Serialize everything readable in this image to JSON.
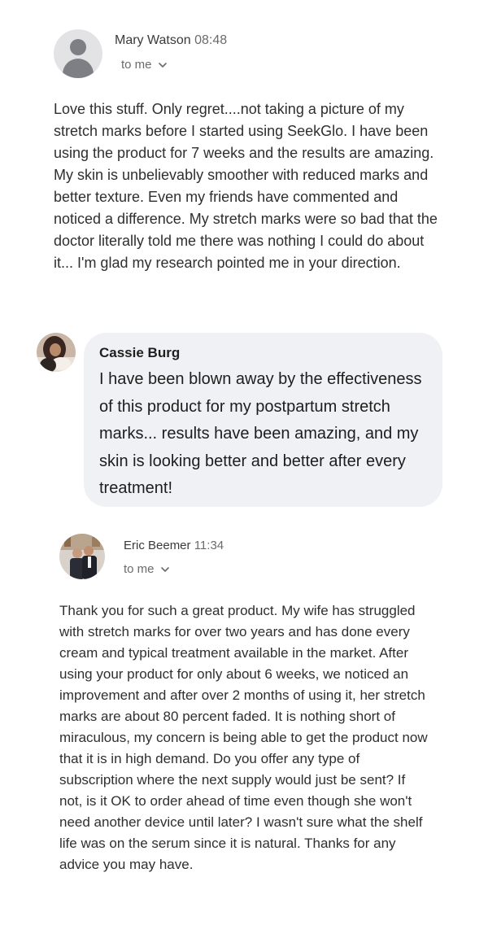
{
  "email1": {
    "sender": "Mary Watson",
    "time": "08:48",
    "to_label": "to me",
    "body": "Love this stuff. Only regret....not taking a picture of my stretch marks before I started using SeekGlo. I have been using the product for 7 weeks and the results are amazing. My skin is unbelievably smoother with reduced marks and better texture. Even my friends have commented and noticed a difference. My stretch marks were so bad that the doctor literally told me there was nothing I could do about it... I'm glad my research pointed me in your direction.",
    "avatar_icon": "default-person-icon"
  },
  "comment": {
    "name": "Cassie Burg",
    "text": "I have been blown away by the effectiveness of this product for my postpartum stretch marks... results have been amazing, and my skin is looking better and better after every treatment!",
    "avatar_icon": "profile-photo"
  },
  "email2": {
    "sender": "Eric Beemer",
    "time": "11:34",
    "to_label": "to me",
    "body": "Thank you for such a great product. My wife has struggled with stretch marks for over two years and has done every cream and typical treatment available in the market. After using your product for only about 6 weeks, we noticed an improvement and after over 2 months of using it, her stretch marks are about 80 percent faded. It is nothing short of miraculous, my concern is being able to get the product now that it is in high demand. Do you offer any type of subscription where the next supply would just be sent? If not, is it OK to order ahead of time even though she won't need another device until later? I wasn't sure what the shelf life was on the serum since it is natural. Thanks for any advice you may have.",
    "avatar_icon": "profile-photo"
  },
  "colors": {
    "bubble_bg": "#f0f1f4",
    "text": "#2f2f2f",
    "muted": "#6b6b6b"
  }
}
